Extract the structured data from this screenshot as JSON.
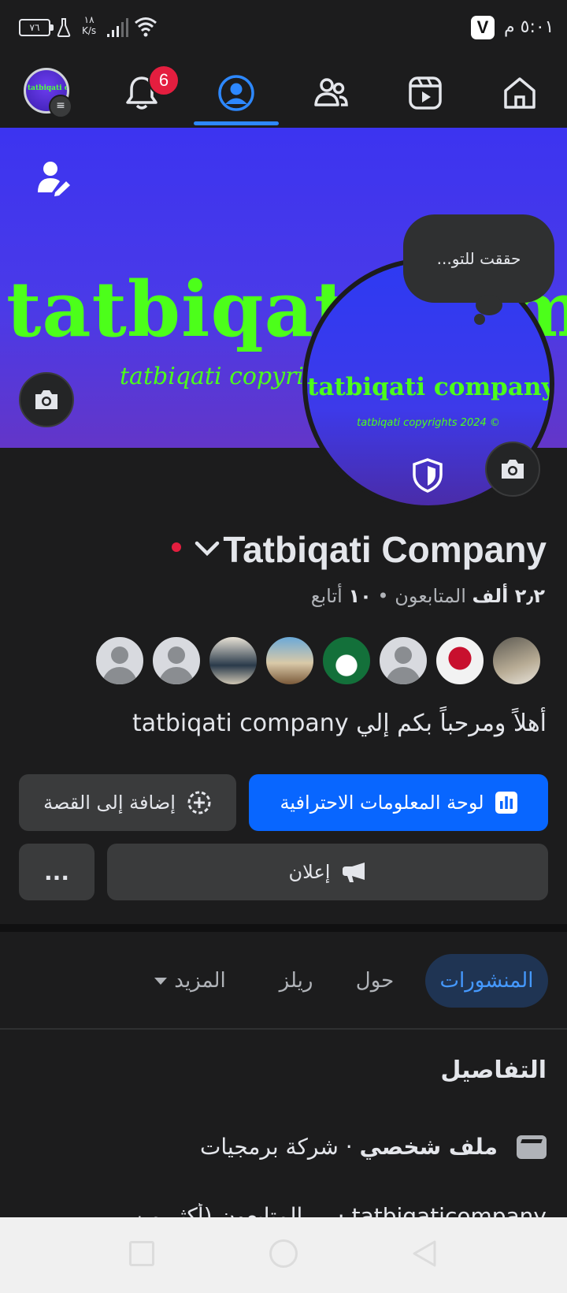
{
  "status_bar": {
    "battery": "٧٦",
    "net_speed_value": "١٨",
    "net_speed_unit": "K/s",
    "app_badge": "V",
    "time": "٥:٠١ م"
  },
  "top_nav": {
    "notification_count": "6",
    "items": [
      "profile-avatar",
      "notifications",
      "profile",
      "friends",
      "reels",
      "home"
    ]
  },
  "cover": {
    "title": "tatbiqati company",
    "subtitle": "tatbiqati copyrig"
  },
  "profile_picture": {
    "title": "tatbiqati company",
    "subtitle": "tatbiqati copyrights 2024 ©"
  },
  "thought_bubble": "حققت للتو...",
  "profile": {
    "name": "Tatbiqati Company",
    "followers_count": "٢٫٢ ألف",
    "followers_label": "المتابعون",
    "following_count": "١٠",
    "following_label": "أتابع",
    "bio": "أهلاً ومرحباً بكم إلي tatbiqati company"
  },
  "buttons": {
    "professional_dashboard": "لوحة المعلومات الاحترافية",
    "add_to_story": "إضافة إلى القصة",
    "advertise": "إعلان",
    "more": "..."
  },
  "tabs": {
    "posts": "المنشورات",
    "about": "حول",
    "reels": "ريلز",
    "more": "المزيد"
  },
  "details": {
    "title": "التفاصيل",
    "page_type_bold": "ملف شخصي",
    "page_type_rest": "· شركة برمجيات",
    "partial_line": "tatbiqaticompany · ... المتابعون (أكثر من"
  },
  "colors": {
    "background": "#1c1c1d",
    "accent_blue": "#0866ff",
    "active_tab_text": "#4599ff",
    "badge_red": "#e41e3f",
    "cover_text_green": "#4cff1a",
    "cover_blue": "#3c34f0"
  }
}
